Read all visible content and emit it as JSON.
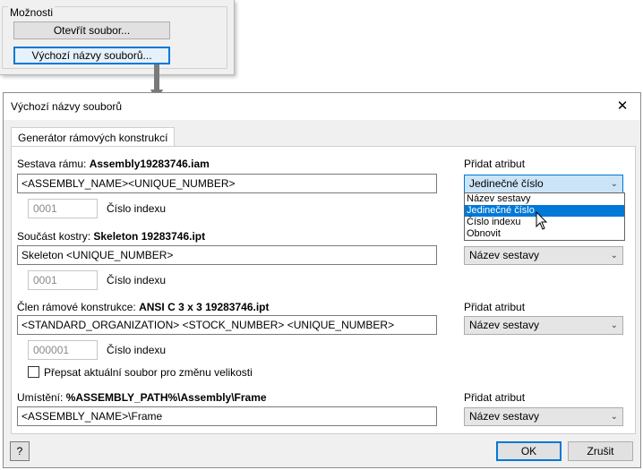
{
  "options": {
    "legend": "Možnosti",
    "open_file_label": "Otevřít soubor...",
    "default_names_label": "Výchozí názvy souborů..."
  },
  "dialog": {
    "title": "Výchozí názvy souborů",
    "tab_label": "Generátor rámových konstrukcí",
    "assembly": {
      "label": "Sestava rámu:",
      "filename": "Assembly19283746.iam",
      "template": "<ASSEMBLY_NAME><UNIQUE_NUMBER>",
      "index_value": "0001",
      "index_label": "Číslo indexu"
    },
    "skeleton": {
      "label": "Součást kostry:",
      "filename": "Skeleton 19283746.ipt",
      "template": "Skeleton <UNIQUE_NUMBER>",
      "index_value": "0001",
      "index_label": "Číslo indexu"
    },
    "member": {
      "label": "Člen rámové konstrukce:",
      "filename": "ANSI C 3 x 3 19283746.ipt",
      "template": "<STANDARD_ORGANIZATION> <STOCK_NUMBER> <UNIQUE_NUMBER>",
      "index_value": "000001",
      "index_label": "Číslo indexu",
      "checkbox_label": "Přepsat aktuální soubor pro změnu velikosti",
      "checkbox_checked": false
    },
    "location": {
      "label": "Umístění:",
      "path": "%ASSEMBLY_PATH%\\Assembly\\Frame",
      "template": "<ASSEMBLY_NAME>\\Frame"
    },
    "add_attribute_label": "Přidat atribut",
    "combos": {
      "assembly_value": "Jedinečné číslo",
      "skeleton_value": "Název sestavy",
      "member_value": "Název sestavy",
      "location_value": "Název sestavy"
    },
    "dropdown_items": [
      {
        "label": "Název sestavy",
        "selected": false
      },
      {
        "label": "Jedinečné číslo",
        "selected": true
      },
      {
        "label": "Číslo indexu",
        "selected": false
      },
      {
        "label": "Obnovit",
        "selected": false
      }
    ],
    "help_label": "?",
    "ok_label": "OK",
    "cancel_label": "Zrušit",
    "close_label": "✕"
  },
  "colors": {
    "accent": "#0078d7",
    "dialog_bg": "#f0f0f0"
  }
}
